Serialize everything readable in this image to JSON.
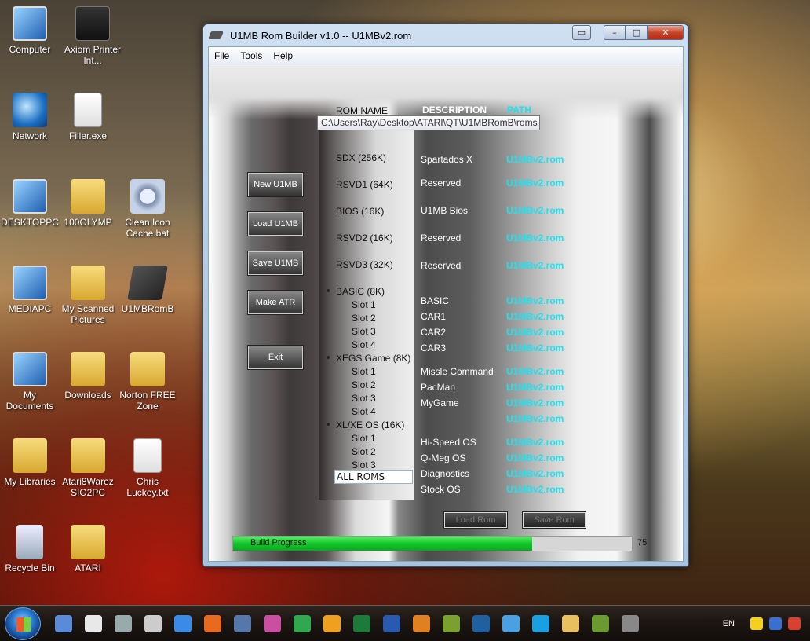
{
  "desktop_icons": [
    {
      "label": "Computer",
      "icon": "computer-icon"
    },
    {
      "label": "Axiom Printer Int...",
      "icon": "printer-icon"
    },
    {
      "label": "Network",
      "icon": "network-icon"
    },
    {
      "label": "Filler.exe",
      "icon": "document-icon"
    },
    {
      "label": "DESKTOPPC",
      "icon": "computer-icon"
    },
    {
      "label": "100OLYMP",
      "icon": "folder-icon"
    },
    {
      "label": "Clean Icon Cache.bat",
      "icon": "gear-icon"
    },
    {
      "label": "MEDIAPC",
      "icon": "computer-icon"
    },
    {
      "label": "My Scanned Pictures",
      "icon": "folder-icon"
    },
    {
      "label": "U1MBRomB",
      "icon": "chip-icon"
    },
    {
      "label": "My Documents",
      "icon": "documents-icon"
    },
    {
      "label": "Downloads",
      "icon": "folder-icon"
    },
    {
      "label": "Norton FREE Zone",
      "icon": "folder-icon"
    },
    {
      "label": "My Libraries",
      "icon": "libraries-icon"
    },
    {
      "label": "Atari8Warez SIO2PC",
      "icon": "folder-icon"
    },
    {
      "label": "Chris Luckey.txt",
      "icon": "text-file-icon"
    },
    {
      "label": "Recycle Bin",
      "icon": "recycle-bin-icon"
    },
    {
      "label": "ATARI",
      "icon": "folder-icon"
    }
  ],
  "window": {
    "title": "U1MB Rom Builder v1.0 -- U1MBv2.rom",
    "menu": [
      "File",
      "Tools",
      "Help"
    ]
  },
  "buttons": {
    "new": "New U1MB",
    "load": "Load U1MB",
    "save": "Save U1MB",
    "make_atr": "Make ATR",
    "exit": "Exit",
    "load_rom": "Load Rom",
    "save_rom": "Save Rom"
  },
  "headers": {
    "rom_name": "ROM  NAME",
    "description": "DESCRIPTION",
    "path": "PATH"
  },
  "roms": [
    {
      "name": "SDX (256K)",
      "sub": false,
      "bullet": false
    },
    {
      "name": "RSVD1 (64K)",
      "sub": false,
      "bullet": false
    },
    {
      "name": "BIOS (16K)",
      "sub": false,
      "bullet": false
    },
    {
      "name": "RSVD2 (16K)",
      "sub": false,
      "bullet": false
    },
    {
      "name": "RSVD3 (32K)",
      "sub": false,
      "bullet": false
    },
    {
      "name": "BASIC (8K)",
      "sub": false,
      "bullet": true
    },
    {
      "name": "Slot 1",
      "sub": true
    },
    {
      "name": "Slot 2",
      "sub": true
    },
    {
      "name": "Slot 3",
      "sub": true
    },
    {
      "name": "Slot 4",
      "sub": true
    },
    {
      "name": "XEGS Game (8K)",
      "sub": false,
      "bullet": true
    },
    {
      "name": "Slot 1",
      "sub": true
    },
    {
      "name": "Slot 2",
      "sub": true
    },
    {
      "name": "Slot 3",
      "sub": true
    },
    {
      "name": "Slot 4",
      "sub": true
    },
    {
      "name": "XL/XE OS (16K)",
      "sub": false,
      "bullet": true
    },
    {
      "name": "Slot 1",
      "sub": true
    },
    {
      "name": "Slot 2",
      "sub": true
    },
    {
      "name": "Slot 3",
      "sub": true
    },
    {
      "name": "Slot 4",
      "sub": true
    }
  ],
  "all_roms": "ALL ROMS",
  "entries": [
    {
      "desc": "Spartados X",
      "path": "U1MBv2.rom"
    },
    {
      "desc": "Reserved",
      "path": "U1MBv2.rom"
    },
    {
      "desc": "U1MB Bios",
      "path": "U1MBv2.rom"
    },
    {
      "desc": "Reserved",
      "path": "U1MBv2.rom"
    },
    {
      "desc": "Reserved",
      "path": "U1MBv2.rom"
    },
    {
      "desc": "BASIC",
      "path": "U1MBv2.rom"
    },
    {
      "desc": "CAR1",
      "path": "U1MBv2.rom"
    },
    {
      "desc": "CAR2",
      "path": "U1MBv2.rom"
    },
    {
      "desc": "CAR3",
      "path": "U1MBv2.rom"
    },
    {
      "desc": "Missle Command",
      "path": "U1MBv2.rom"
    },
    {
      "desc": "PacMan",
      "path": "U1MBv2.rom"
    },
    {
      "desc": "MyGame",
      "path": "U1MBv2.rom"
    },
    {
      "desc": "",
      "path": "U1MBv2.rom"
    },
    {
      "desc": "Hi-Speed OS",
      "path": "U1MBv2.rom"
    },
    {
      "desc": "Q-Meg OS",
      "path": "U1MBv2.rom"
    },
    {
      "desc": "Diagnostics",
      "path": "U1MBv2.rom"
    },
    {
      "desc": "Stock OS",
      "path": "U1MBv2.rom"
    }
  ],
  "tooltip": "C:\\Users\\Ray\\Desktop\\ATARI\\QT\\U1MBRomB\\roms",
  "progress": {
    "label": "Build Progress",
    "value": 75,
    "max": 100
  },
  "taskbar": {
    "language": "EN",
    "icons": [
      "start-icon",
      "mail-icon",
      "document-icon",
      "scanner-icon",
      "edit-icon",
      "ie-icon",
      "firefox-icon",
      "app-icon",
      "flower-icon",
      "utorrent-icon",
      "outlook-icon",
      "excel-icon",
      "word-icon",
      "game-icon",
      "app-icon",
      "photoshop-icon",
      "globe-icon",
      "skype-icon",
      "explorer-icon",
      "app-icon",
      "u1mb-icon"
    ]
  },
  "colors": {
    "path_text": "#19e4f0",
    "progress_fill": "#12c52a",
    "header_desc": "#ffffff"
  }
}
